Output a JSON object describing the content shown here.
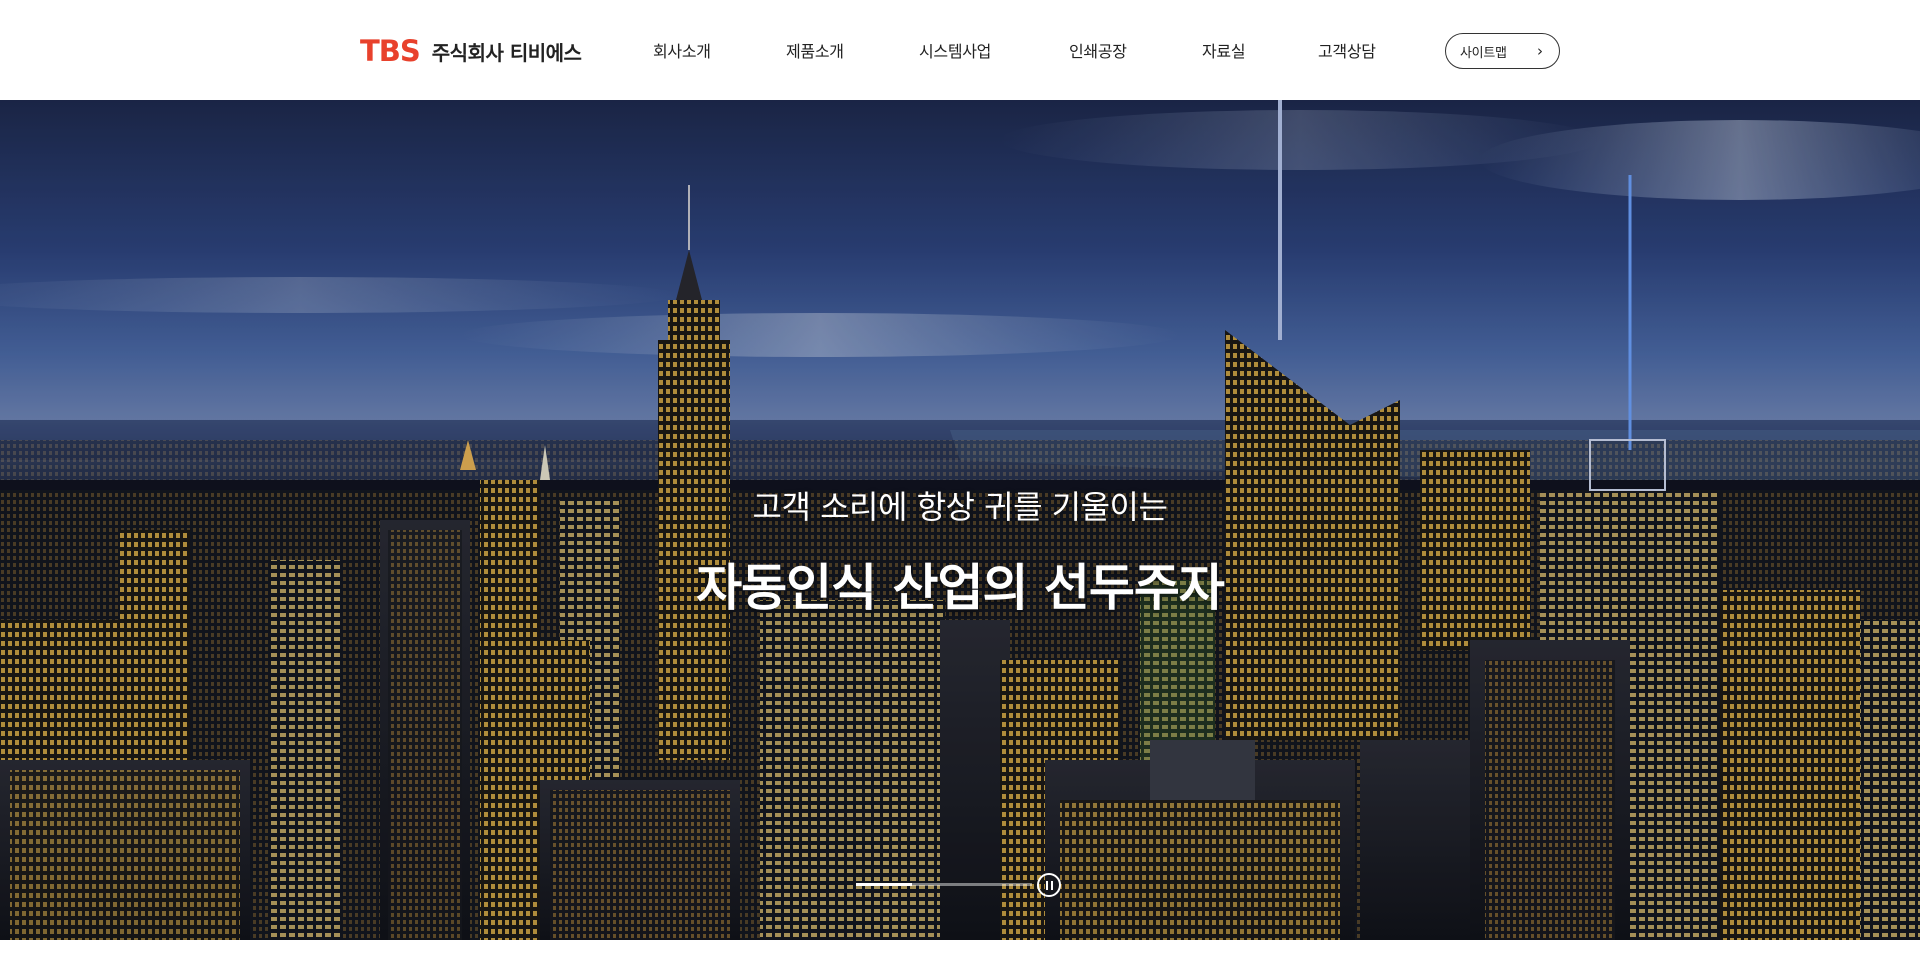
{
  "header": {
    "logo_mark": "TBS",
    "company_name": "주식회사 티비에스",
    "brand_color": "#e8412c",
    "nav": [
      {
        "label": "회사소개"
      },
      {
        "label": "제품소개"
      },
      {
        "label": "시스템사업"
      },
      {
        "label": "인쇄공장"
      },
      {
        "label": "자료실"
      },
      {
        "label": "고객상담"
      }
    ],
    "sitemap_label": "사이트맵",
    "sitemap_icon": "chevron-right-icon"
  },
  "hero": {
    "subtitle": "고객 소리에 항상 귀를 기울이는",
    "title": "자동인식 산업의 선두주자",
    "slide_progress": 0.32,
    "pause_icon": "pause-icon"
  }
}
